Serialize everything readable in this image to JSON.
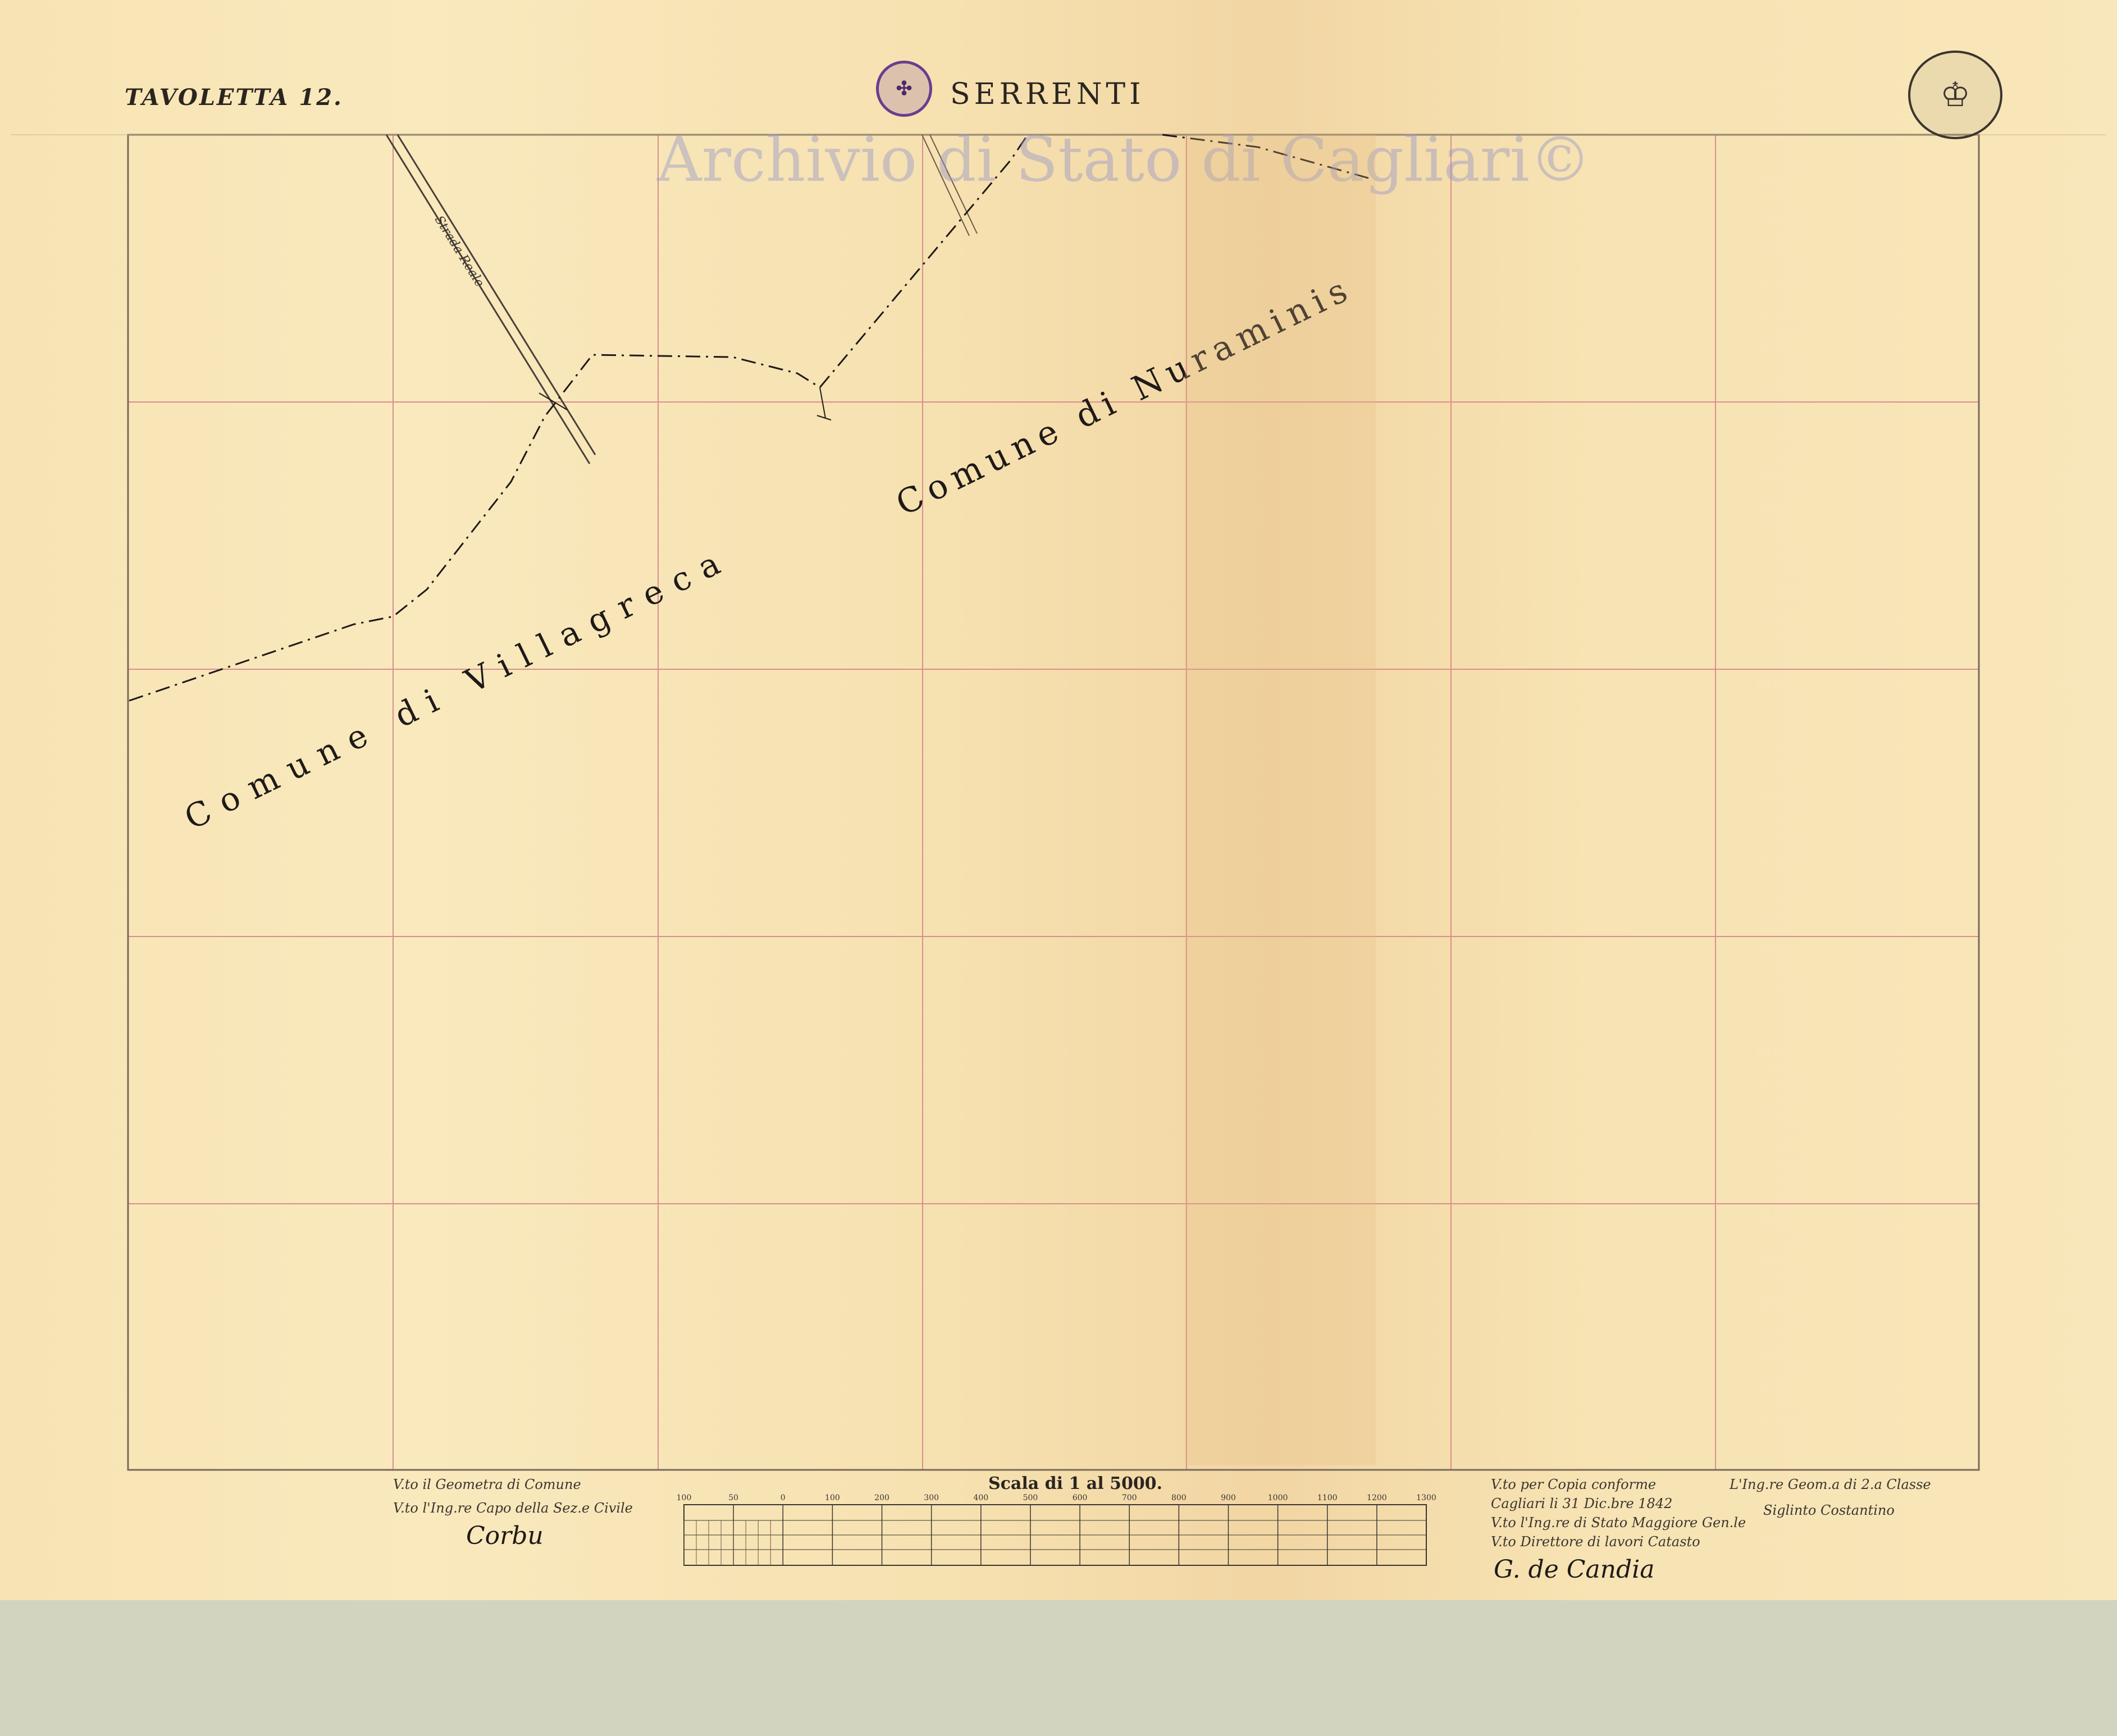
{
  "header": {
    "sheet_number": "TAVOLETTA 12.",
    "title": "SERRENTI",
    "watermark": "Archivio di Stato di Cagliari©"
  },
  "map": {
    "labels": {
      "comune_villagreca": "Comune di Villagreca",
      "comune_nuraminis": "Comune di Nuraminis",
      "road": "Strada Reale"
    }
  },
  "scale_bar": {
    "title": "Scala di 1 al 5000.",
    "ticks": [
      "100",
      "50",
      "0",
      "100",
      "200",
      "300",
      "400",
      "500",
      "600",
      "700",
      "800",
      "900",
      "1000",
      "1100",
      "1200",
      "1300"
    ]
  },
  "signatures": {
    "left_line1": "V.to il Geometra di Comune",
    "left_line2": "V.to l'Ing.re Capo della Sez.e Civile",
    "left_sign": "Corbu",
    "middle_line1": "V.to per Copia conforme",
    "middle_line2": "Cagliari li 31 Dic.bre 1842",
    "middle_line3": "V.to l'Ing.re di Stato Maggiore Gen.le",
    "middle_line4": "V.to Direttore di lavori Catasto",
    "middle_sign": "G. de Candia",
    "right_line1": "L'Ing.re Geom.a di 2.a Classe",
    "right_line2": "Siglinto Costantino"
  },
  "colors": {
    "paper": "#f7e4b4",
    "grid": "#d98e8e",
    "border": "#7a6a5a",
    "ink": "#1e1a18",
    "stamp": "#6a3d8e",
    "background": "#d2d4bf"
  }
}
